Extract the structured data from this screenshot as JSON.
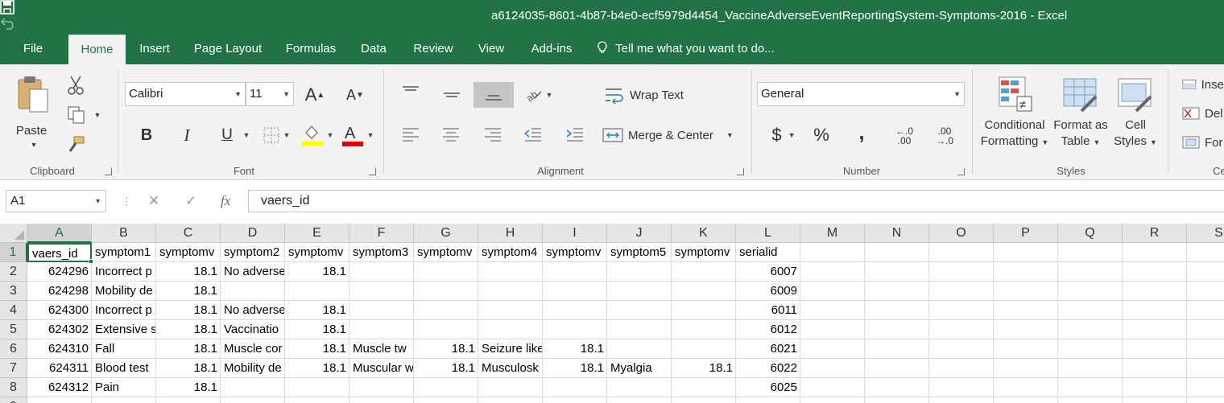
{
  "window": {
    "title": "a6124035-8601-4b87-b4e0-ecf5979d4454_VaccineAdverseEventReportingSystem-Symptoms-2016 - Excel"
  },
  "tabs": [
    "File",
    "Home",
    "Insert",
    "Page Layout",
    "Formulas",
    "Data",
    "Review",
    "View",
    "Add-ins"
  ],
  "tell_me": "Tell me what you want to do...",
  "ribbon": {
    "clipboard": {
      "label": "Clipboard",
      "paste": "Paste"
    },
    "font": {
      "label": "Font",
      "name": "Calibri",
      "size": "11",
      "bold": "B",
      "italic": "I",
      "underline": "U"
    },
    "alignment": {
      "label": "Alignment",
      "wrap": "Wrap Text",
      "merge": "Merge & Center"
    },
    "number": {
      "label": "Number",
      "format": "General",
      "currency": "$",
      "percent": "%",
      "comma": ",",
      "inc_dec_top": "←.0",
      "inc_dec_bottom": ".00",
      "dec_dec_top": ".00",
      "dec_dec_bottom": "→.0"
    },
    "styles": {
      "label": "Styles",
      "conditional_1": "Conditional",
      "conditional_2": "Formatting",
      "format_table_1": "Format as",
      "format_table_2": "Table",
      "cell_styles_1": "Cell",
      "cell_styles_2": "Styles"
    },
    "cells": {
      "label": "Ce",
      "insert": "Inse",
      "delete": "Del",
      "format": "For"
    }
  },
  "formula_bar": {
    "name_box": "A1",
    "fx": "fx",
    "value": "vaers_id"
  },
  "grid": {
    "columns": [
      "A",
      "B",
      "C",
      "D",
      "E",
      "F",
      "G",
      "H",
      "I",
      "J",
      "K",
      "L",
      "M",
      "N",
      "O",
      "P",
      "Q",
      "R",
      "S"
    ],
    "row_numbers": [
      "1",
      "2",
      "3",
      "4",
      "5",
      "6",
      "7",
      "8",
      "9"
    ],
    "rows": [
      [
        "vaers_id",
        "symptom1",
        "symptomv",
        "symptom2",
        "symptomv",
        "symptom3",
        "symptomv",
        "symptom4",
        "symptomv",
        "symptom5",
        "symptomv",
        "serialid"
      ],
      [
        "624296",
        "Incorrect p",
        "18.1",
        "No adverse",
        "18.1",
        "",
        "",
        "",
        "",
        "",
        "",
        "6007"
      ],
      [
        "624298",
        "Mobility de",
        "18.1",
        "",
        "",
        "",
        "",
        "",
        "",
        "",
        "",
        "6009"
      ],
      [
        "624300",
        "Incorrect p",
        "18.1",
        "No adverse",
        "18.1",
        "",
        "",
        "",
        "",
        "",
        "",
        "6011"
      ],
      [
        "624302",
        "Extensive s",
        "18.1",
        "Vaccinatio",
        "18.1",
        "",
        "",
        "",
        "",
        "",
        "",
        "6012"
      ],
      [
        "624310",
        "Fall",
        "18.1",
        "Muscle cor",
        "18.1",
        "Muscle tw",
        "18.1",
        "Seizure like",
        "18.1",
        "",
        "",
        "6021"
      ],
      [
        "624311",
        "Blood test",
        "18.1",
        "Mobility de",
        "18.1",
        "Muscular w",
        "18.1",
        "Musculosk",
        "18.1",
        "Myalgia",
        "18.1",
        "6022"
      ],
      [
        "624312",
        "Pain",
        "18.1",
        "",
        "",
        "",
        "",
        "",
        "",
        "",
        "",
        "6025"
      ],
      [
        "",
        "",
        "",
        "",
        "",
        "",
        "",
        "",
        "",
        "",
        "",
        ""
      ]
    ]
  },
  "colors": {
    "accent": "#217346",
    "ribbon_bg": "#f3f3f3",
    "header_bg": "#e6e6e6"
  }
}
